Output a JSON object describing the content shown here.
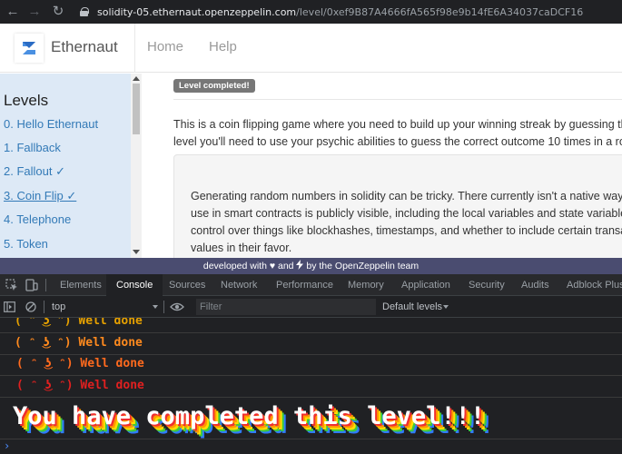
{
  "browser": {
    "url_host": "solidity-05.ethernaut.openzeppelin.com",
    "url_path": "/level/0xef9B87A4666fA565f98e9b14fE6A34037caDCF16"
  },
  "header": {
    "brand": "Ethernaut",
    "nav": [
      "Home",
      "Help"
    ]
  },
  "sidebar": {
    "title": "Levels",
    "items": [
      {
        "label": "0. Hello Ethernaut"
      },
      {
        "label": "1. Fallback"
      },
      {
        "label": "2. Fallout ✓"
      },
      {
        "label": "3. Coin Flip ✓"
      },
      {
        "label": "4. Telephone"
      },
      {
        "label": "5. Token"
      }
    ]
  },
  "main": {
    "badge": "Level completed!",
    "intro_lines": [
      "This is a coin flipping game where you need to build up your winning streak by guessing the ou",
      "level you'll need to use your psychic abilities to guess the correct outcome 10 times in a row."
    ],
    "note_lines": [
      "Generating random numbers in solidity can be tricky. There currently isn't a native way to",
      "use in smart contracts is publicly visible, including the local variables and state variables m",
      "control over things like blockhashes, timestamps, and whether to include certain transacti",
      "values in their favor."
    ]
  },
  "footer": {
    "prefix": "developed with",
    "middle": "and",
    "suffix": "by the OpenZeppelin team",
    "heart": "♥"
  },
  "devtools": {
    "tabs": [
      "Elements",
      "Console",
      "Sources",
      "Network",
      "Performance",
      "Memory",
      "Application",
      "Security",
      "Audits",
      "Adblock Plus"
    ],
    "active_tab": "Console",
    "context": "top",
    "filter_placeholder": "Filter",
    "levels": "Default levels",
    "logs": [
      {
        "text": "( ᵔ ͜ʖ ᵔ) Well done",
        "color": "#e5a000"
      },
      {
        "text": "( ᵔ ͜ʖ ᵔ) Well done",
        "color": "#ff8a1e"
      },
      {
        "text": "( ᵔ ͜ʖ ᵔ) Well done",
        "color": "#ff6a1e"
      },
      {
        "text": "( ᵔ ͜ʖ ᵔ) Well done",
        "color": "#e02020"
      }
    ],
    "final_message": "You have completed this level!!!",
    "prompt": "›"
  }
}
